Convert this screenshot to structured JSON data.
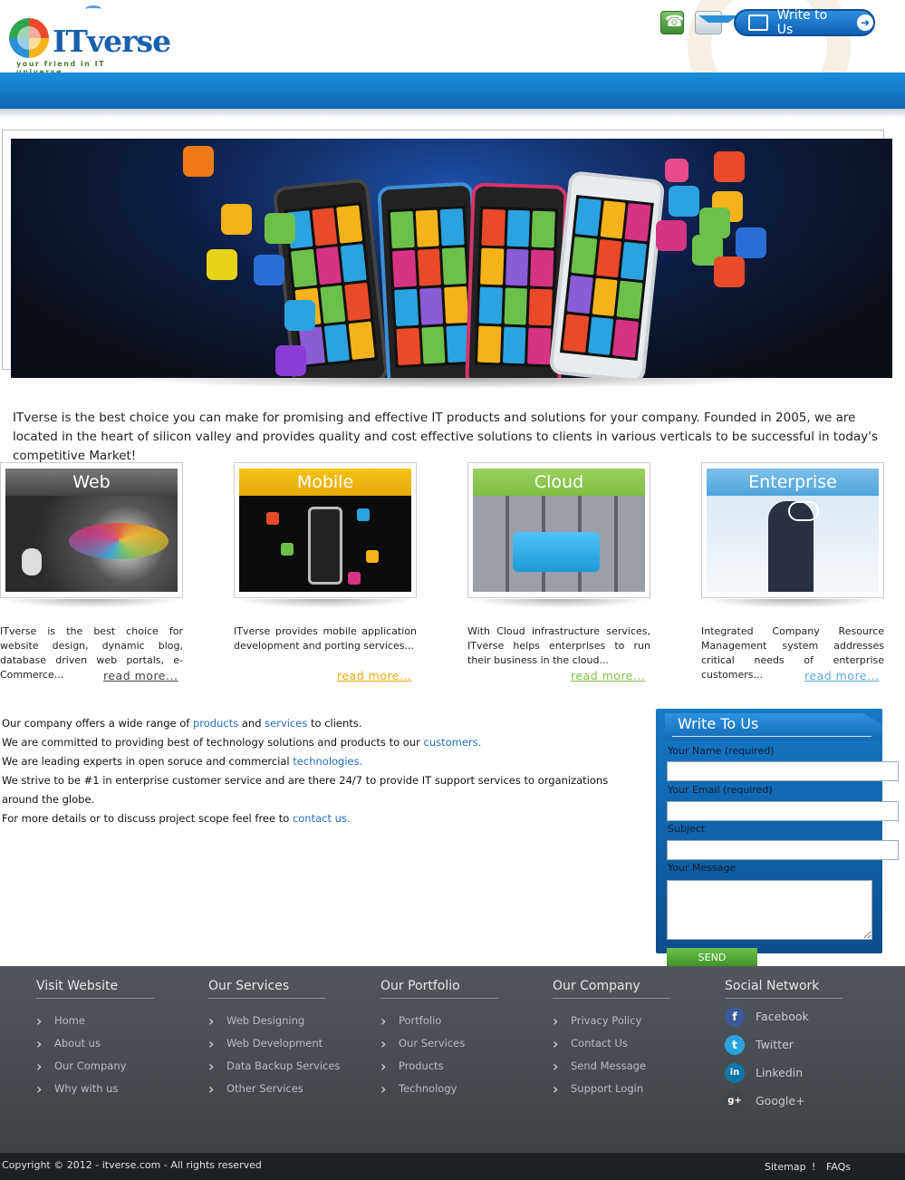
{
  "header": {
    "logo_text": "ITverse",
    "logo_tagline": "your friend in IT universe",
    "write_button": "Write to Us",
    "icons": [
      "phone-icon",
      "mail-icon",
      "pen-icon",
      "arrow-right-icon"
    ]
  },
  "intro": "ITverse is the best choice you can make for promising and effective IT products and solutions for your company. Founded in 2005, we are located in the heart of silicon valley and provides quality and cost effective solutions to clients in various verticals to be successful in today's competitive Market!",
  "services": [
    {
      "title": "Web",
      "color": "#5a5a5a",
      "description": "ITverse is the best choice for website design, dynamic blog, database driven web portals, e-Commerce...",
      "more": "read more..."
    },
    {
      "title": "Mobile",
      "color": "#f0b90c",
      "description": "ITverse provides mobile application development and porting services...",
      "more": "read more..."
    },
    {
      "title": "Cloud",
      "color": "#8cc152",
      "description": "With Cloud infrastructure services, ITverse helps enterprises to run their business in the cloud...",
      "more": "read more..."
    },
    {
      "title": "Enterprise",
      "color": "#5aa9dc",
      "description": "Integrated Company Resource Management system addresses critical needs of enterprise customers...",
      "more": "read more..."
    }
  ],
  "company": {
    "l1_a": "Our company offers a wide range of ",
    "l1_link1": "products",
    "l1_b": " and ",
    "l1_link2": "services",
    "l1_c": " to clients.",
    "l2_a": "We are committed to providing best of technology solutions and products to our ",
    "l2_link": "customers.",
    "l3_a": "We are leading experts in open soruce and commercial ",
    "l3_link": "technologies.",
    "l4": "We strive to be #1 in enterprise customer service and are there 24/7 to provide IT support services to organizations around the globe.",
    "l5_a": "For more details or to discuss project scope feel free to ",
    "l5_link": "contact us."
  },
  "form": {
    "title": "Write To Us",
    "name_label": "Your Name (required)",
    "email_label": "Your Email (required)",
    "subject_label": "Subject",
    "message_label": "Your Message",
    "send": "SEND"
  },
  "footer": {
    "columns": [
      {
        "title": "Visit Website",
        "items": [
          "Home",
          "About us",
          "Our Company",
          "Why with us"
        ]
      },
      {
        "title": "Our Services",
        "items": [
          "Web Designing",
          "Web Development",
          "Data Backup Services",
          "Other Services"
        ]
      },
      {
        "title": "Our Portfolio",
        "items": [
          "Portfolio",
          "Our Services",
          "Products",
          "Technology"
        ]
      },
      {
        "title": "Our Company",
        "items": [
          "Privacy Policy",
          "Contact Us",
          "Send Message",
          "Support Login"
        ]
      }
    ],
    "social": {
      "title": "Social Network",
      "items": [
        {
          "label": "Facebook",
          "icon": "facebook-icon",
          "glyph": "f",
          "color": "#3b5998"
        },
        {
          "label": "Twitter",
          "icon": "twitter-icon",
          "glyph": "t",
          "color": "#2aa3e0"
        },
        {
          "label": "Linkedin",
          "icon": "linkedin-icon",
          "glyph": "in",
          "color": "#0e76a8"
        },
        {
          "label": "Google+",
          "icon": "googleplus-icon",
          "glyph": "g+",
          "color": "#444"
        }
      ]
    },
    "copyright": "Copyright © 2012 - itverse.com - All rights reserved",
    "sitemap": "Sitemap",
    "separator": "!",
    "faqs": "FAQs"
  },
  "colors": {
    "brand_blue": "#0f6fc3",
    "link_blue": "#1f6dbd",
    "footer_dark": "#3e4347",
    "send_green": "#4fa532"
  }
}
